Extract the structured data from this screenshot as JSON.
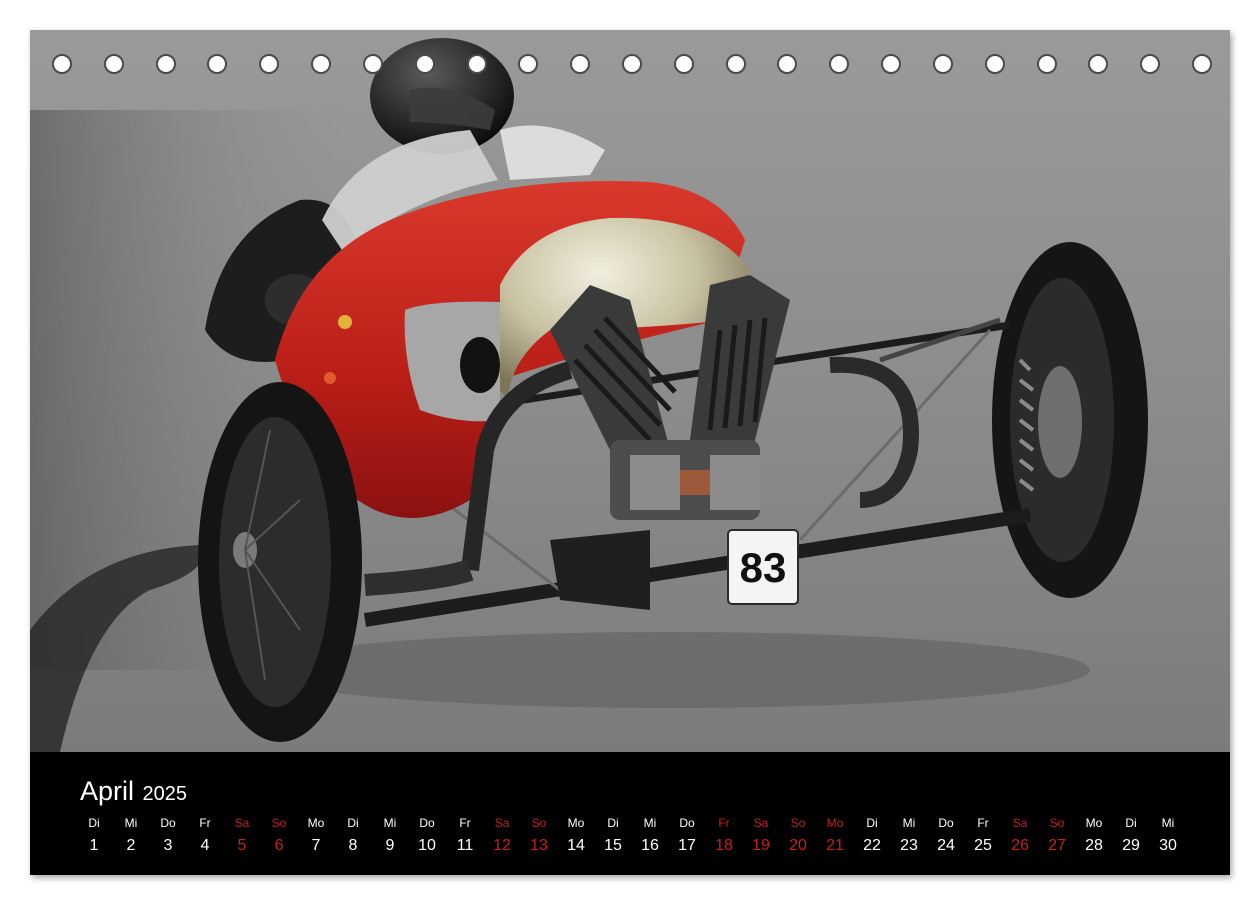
{
  "calendar": {
    "month": "April",
    "year": "2025",
    "colors": {
      "weekday": "#ffffff",
      "weekend_holiday": "#c81e1e",
      "bar_background": "#000000"
    },
    "days": [
      {
        "dow": "Di",
        "day": "1",
        "red": false
      },
      {
        "dow": "Mi",
        "day": "2",
        "red": false
      },
      {
        "dow": "Do",
        "day": "3",
        "red": false
      },
      {
        "dow": "Fr",
        "day": "4",
        "red": false
      },
      {
        "dow": "Sa",
        "day": "5",
        "red": true
      },
      {
        "dow": "So",
        "day": "6",
        "red": true
      },
      {
        "dow": "Mo",
        "day": "7",
        "red": false
      },
      {
        "dow": "Di",
        "day": "8",
        "red": false
      },
      {
        "dow": "Mi",
        "day": "9",
        "red": false
      },
      {
        "dow": "Do",
        "day": "10",
        "red": false
      },
      {
        "dow": "Fr",
        "day": "11",
        "red": false
      },
      {
        "dow": "Sa",
        "day": "12",
        "red": true
      },
      {
        "dow": "So",
        "day": "13",
        "red": true
      },
      {
        "dow": "Mo",
        "day": "14",
        "red": false
      },
      {
        "dow": "Di",
        "day": "15",
        "red": false
      },
      {
        "dow": "Mi",
        "day": "16",
        "red": false
      },
      {
        "dow": "Do",
        "day": "17",
        "red": false
      },
      {
        "dow": "Fr",
        "day": "18",
        "red": true
      },
      {
        "dow": "Sa",
        "day": "19",
        "red": true
      },
      {
        "dow": "So",
        "day": "20",
        "red": true
      },
      {
        "dow": "Mo",
        "day": "21",
        "red": true
      },
      {
        "dow": "Di",
        "day": "22",
        "red": false
      },
      {
        "dow": "Mi",
        "day": "23",
        "red": false
      },
      {
        "dow": "Do",
        "day": "24",
        "red": false
      },
      {
        "dow": "Fr",
        "day": "25",
        "red": false
      },
      {
        "dow": "Sa",
        "day": "26",
        "red": true
      },
      {
        "dow": "So",
        "day": "27",
        "red": true
      },
      {
        "dow": "Mo",
        "day": "28",
        "red": false
      },
      {
        "dow": "Di",
        "day": "29",
        "red": false
      },
      {
        "dow": "Mi",
        "day": "30",
        "red": false
      }
    ]
  },
  "photo": {
    "subject": "vintage-three-wheeler-race-car",
    "race_number": "83",
    "colors": {
      "body_red": "#c0211c",
      "road_gray": "#8e8e8e"
    }
  },
  "binding": {
    "icon": "spiral-binding-ring-icon",
    "count": 23
  }
}
